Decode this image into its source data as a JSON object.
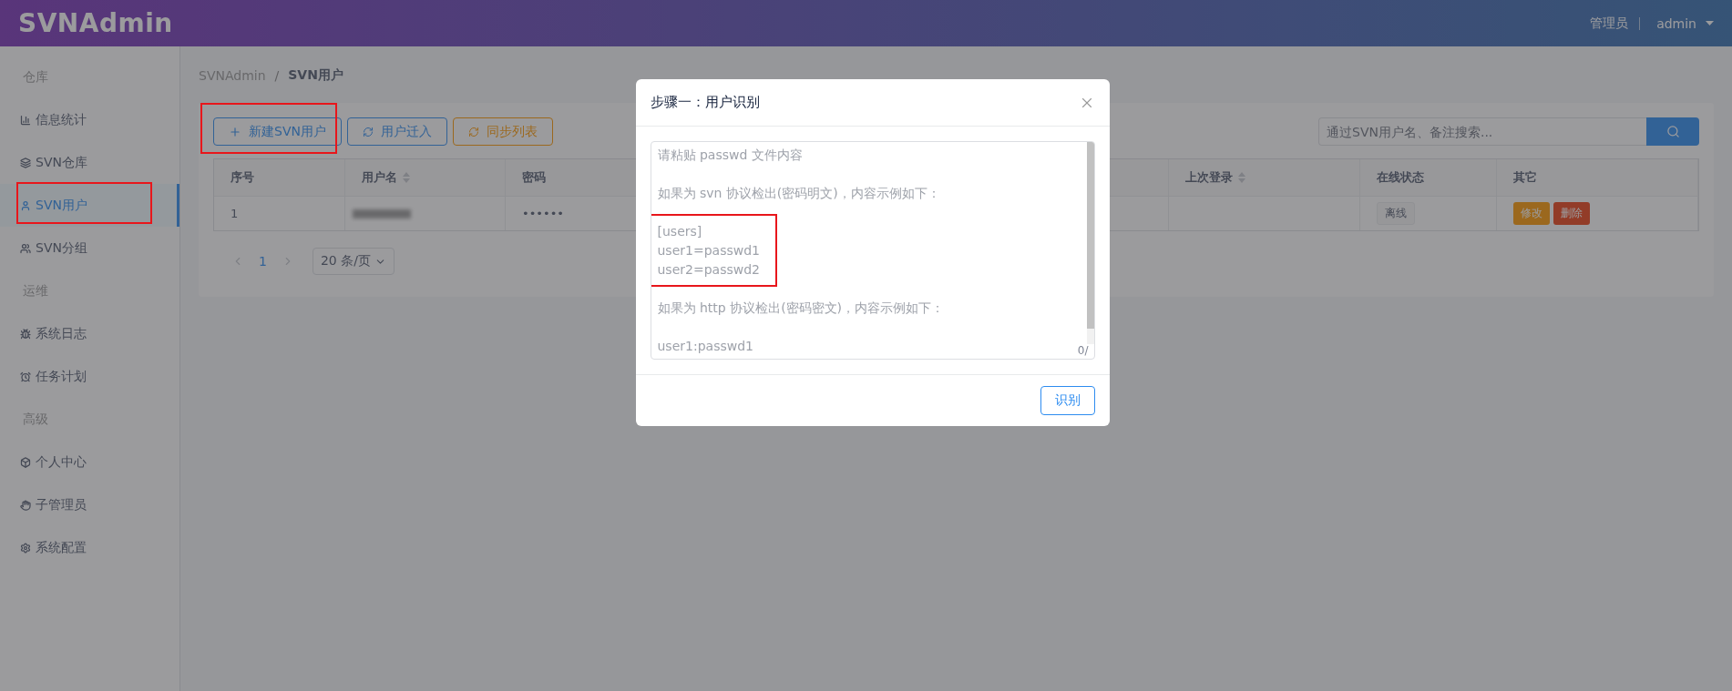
{
  "header": {
    "logo": "SVNAdmin",
    "role": "管理员",
    "user": "admin"
  },
  "sidebar": {
    "items": [
      {
        "kind": "group",
        "label": "仓库"
      },
      {
        "kind": "item",
        "label": "信息统计",
        "selected": false
      },
      {
        "kind": "item",
        "label": "SVN仓库",
        "selected": false
      },
      {
        "kind": "item",
        "label": "SVN用户",
        "selected": true
      },
      {
        "kind": "item",
        "label": "SVN分组",
        "selected": false
      },
      {
        "kind": "group",
        "label": "运维"
      },
      {
        "kind": "item",
        "label": "系统日志",
        "selected": false
      },
      {
        "kind": "item",
        "label": "任务计划",
        "selected": false
      },
      {
        "kind": "group",
        "label": "高级"
      },
      {
        "kind": "item",
        "label": "个人中心",
        "selected": false
      },
      {
        "kind": "item",
        "label": "子管理员",
        "selected": false
      },
      {
        "kind": "item",
        "label": "系统配置",
        "selected": false
      }
    ]
  },
  "breadcrumb": {
    "separator": "/",
    "items": [
      "SVNAdmin",
      "SVN用户"
    ]
  },
  "toolbar": {
    "buttons": [
      {
        "kind": "primary",
        "label": "新建SVN用户"
      },
      {
        "kind": "info",
        "label": "用户迁入"
      },
      {
        "kind": "warning",
        "label": "同步列表"
      }
    ],
    "search": {
      "placeholder": "通过SVN用户名、备注搜索..."
    }
  },
  "table": {
    "columns": [
      {
        "label": "序号",
        "sortable": false
      },
      {
        "label": "用户名",
        "sortable": true
      },
      {
        "label": "密码",
        "sortable": false
      },
      {
        "label": "上次登录",
        "sortable": true
      },
      {
        "label": "在线状态",
        "sortable": false
      },
      {
        "label": "其它",
        "sortable": false
      }
    ],
    "rows": [
      {
        "index": "1",
        "password": "••••••",
        "status": "离线",
        "actions": [
          {
            "kind": "warning",
            "label": "修改"
          },
          {
            "kind": "error",
            "label": "删除"
          }
        ]
      }
    ]
  },
  "pagination": {
    "pages": [
      {
        "label": "1",
        "selected": true
      }
    ],
    "page_size": "20 条/页"
  },
  "modal": {
    "title": "步骤一：用户识别",
    "placeholder": [
      {
        "lines": [
          "请粘贴 passwd 文件内容"
        ],
        "highlighted": false
      },
      {
        "lines": [
          "如果为 svn 协议检出(密码明文)，内容示例如下："
        ],
        "highlighted": false
      },
      {
        "lines": [
          "[users]",
          "user1=passwd1",
          "user2=passwd2"
        ],
        "highlighted": true
      },
      {
        "lines": [
          "如果为 http 协议检出(密码密文)，内容示例如下："
        ],
        "highlighted": false
      },
      {
        "lines": [
          "user1:passwd1"
        ],
        "highlighted": false
      }
    ],
    "count": "0/",
    "button": "识别"
  }
}
